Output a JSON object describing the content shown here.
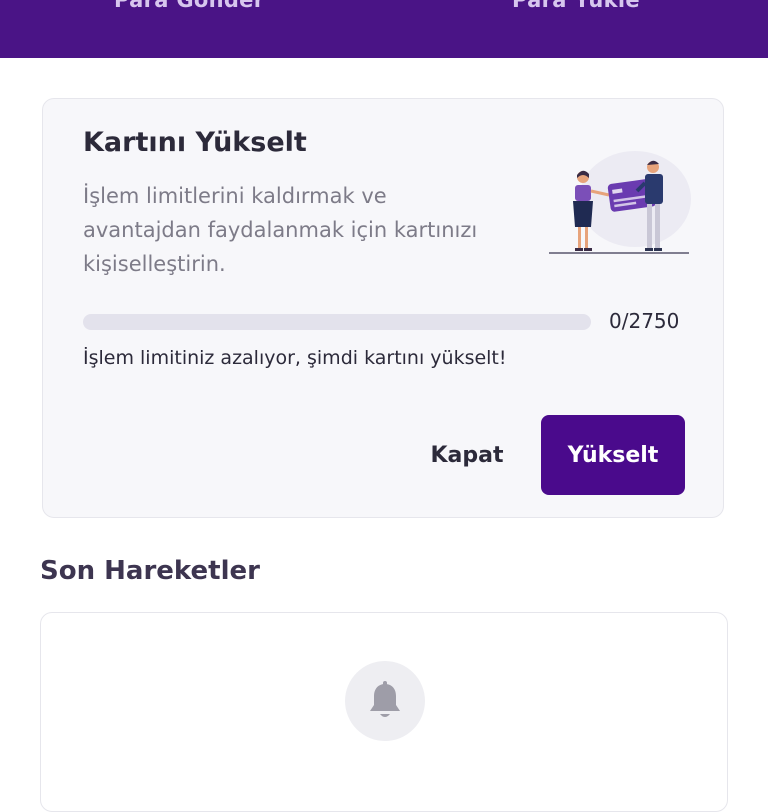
{
  "top_actions": {
    "send_label": "Para Gönder",
    "load_label": "Para Yükle"
  },
  "upgrade_card": {
    "title": "Kartını Yükselt",
    "description": "İşlem limitlerini kaldırmak ve avantajdan faydalanmak için kartınızı kişiselleştirin.",
    "progress_text": "0/2750",
    "progress_fraction": 0,
    "warning": "İşlem limitiniz azalıyor, şimdi kartını yükselt!",
    "close_label": "Kapat",
    "upgrade_label": "Yükselt"
  },
  "recent": {
    "title": "Son Hareketler",
    "empty_text": ""
  },
  "colors": {
    "brand": "#4a1486",
    "button": "#4a0a8c",
    "text_dark": "#2c2a3a",
    "text_muted": "#7d7b88"
  },
  "icons": {
    "bell": "bell-icon",
    "illustration": "card-upgrade-illustration"
  }
}
